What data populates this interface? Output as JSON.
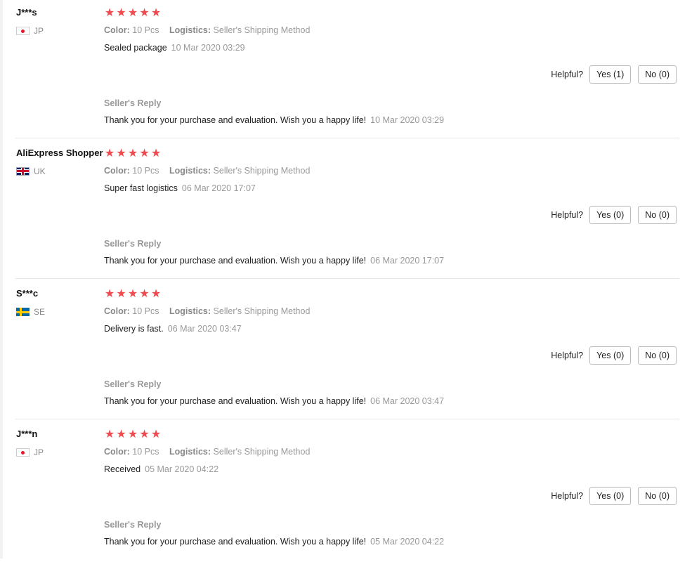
{
  "labels": {
    "color": "Color:",
    "logistics": "Logistics:",
    "helpful": "Helpful?",
    "seller_reply": "Seller's Reply"
  },
  "star_color": "#ef4a4e",
  "reviews": [
    {
      "user": "J***s",
      "country": "JP",
      "flag": "jp-flag-icon",
      "rating": 5,
      "color_value": "10 Pcs",
      "logistics_value": "Seller's Shipping Method",
      "text": "Sealed package",
      "date": "10 Mar 2020 03:29",
      "yes_label": "Yes (1)",
      "no_label": "No (0)",
      "reply": "Thank you for your purchase and evaluation. Wish you a happy life!",
      "reply_date": "10 Mar 2020 03:29"
    },
    {
      "user": "AliExpress Shopper",
      "country": "UK",
      "flag": "uk-flag-icon",
      "rating": 5,
      "color_value": "10 Pcs",
      "logistics_value": "Seller's Shipping Method",
      "text": "Super fast logistics",
      "date": "06 Mar 2020 17:07",
      "yes_label": "Yes (0)",
      "no_label": "No (0)",
      "reply": "Thank you for your purchase and evaluation. Wish you a happy life!",
      "reply_date": "06 Mar 2020 17:07"
    },
    {
      "user": "S***c",
      "country": "SE",
      "flag": "se-flag-icon",
      "rating": 5,
      "color_value": "10 Pcs",
      "logistics_value": "Seller's Shipping Method",
      "text": "Delivery is fast.",
      "date": "06 Mar 2020 03:47",
      "yes_label": "Yes (0)",
      "no_label": "No (0)",
      "reply": "Thank you for your purchase and evaluation. Wish you a happy life!",
      "reply_date": "06 Mar 2020 03:47"
    },
    {
      "user": "J***n",
      "country": "JP",
      "flag": "jp-flag-icon",
      "rating": 5,
      "color_value": "10 Pcs",
      "logistics_value": "Seller's Shipping Method",
      "text": "Received",
      "date": "05 Mar 2020 04:22",
      "yes_label": "Yes (0)",
      "no_label": "No (0)",
      "reply": "Thank you for your purchase and evaluation. Wish you a happy life!",
      "reply_date": "05 Mar 2020 04:22"
    }
  ]
}
